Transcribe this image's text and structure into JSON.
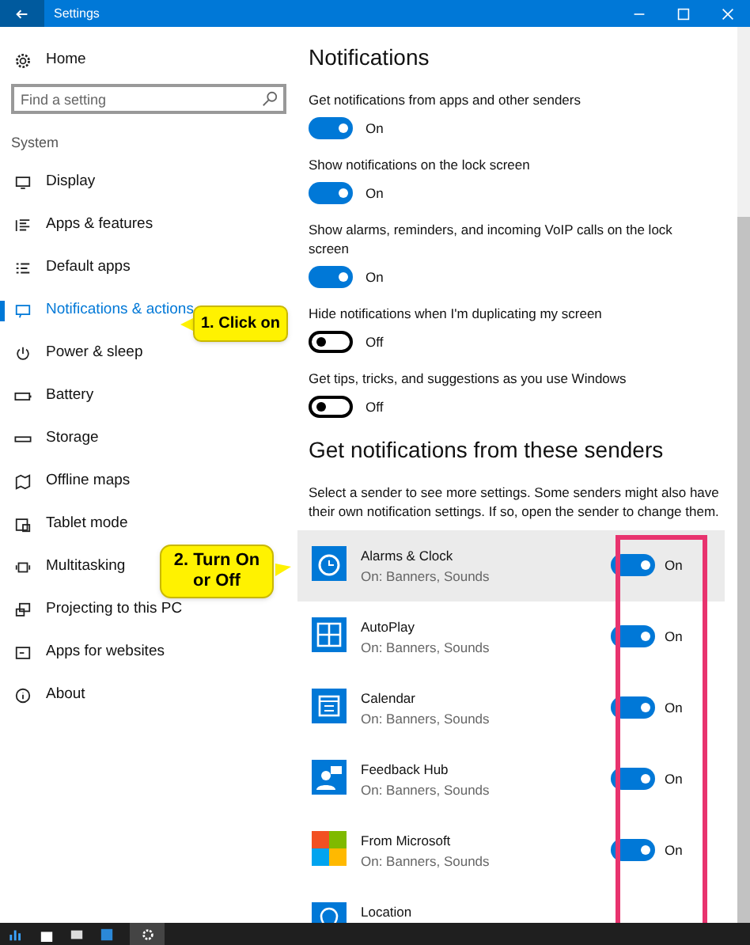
{
  "window": {
    "title": "Settings"
  },
  "sidebar": {
    "home": "Home",
    "search": {
      "placeholder": "Find a setting"
    },
    "section": "System",
    "items": [
      {
        "label": "Display",
        "selected": false
      },
      {
        "label": "Apps & features",
        "selected": false
      },
      {
        "label": "Default apps",
        "selected": false
      },
      {
        "label": "Notifications & actions",
        "selected": true
      },
      {
        "label": "Power & sleep",
        "selected": false
      },
      {
        "label": "Battery",
        "selected": false
      },
      {
        "label": "Storage",
        "selected": false
      },
      {
        "label": "Offline maps",
        "selected": false
      },
      {
        "label": "Tablet mode",
        "selected": false
      },
      {
        "label": "Multitasking",
        "selected": false
      },
      {
        "label": "Projecting to this PC",
        "selected": false
      },
      {
        "label": "Apps for websites",
        "selected": false
      },
      {
        "label": "About",
        "selected": false
      }
    ]
  },
  "main": {
    "heading": "Notifications",
    "settings": [
      {
        "label": "Get notifications from apps and other senders",
        "on": true,
        "state_text": "On"
      },
      {
        "label": "Show notifications on the lock screen",
        "on": true,
        "state_text": "On"
      },
      {
        "label": "Show alarms, reminders, and incoming VoIP calls on the lock screen",
        "on": true,
        "state_text": "On"
      },
      {
        "label": "Hide notifications when I'm duplicating my screen",
        "on": false,
        "state_text": "Off"
      },
      {
        "label": "Get tips, tricks, and suggestions as you use Windows",
        "on": false,
        "state_text": "Off"
      }
    ],
    "senders_heading": "Get notifications from these senders",
    "senders_description": "Select a sender to see more settings. Some senders might also have their own notification settings. If so, open the sender to change them.",
    "senders": [
      {
        "name": "Alarms & Clock",
        "subtitle": "On: Banners, Sounds",
        "on": true,
        "state_text": "On",
        "selected": true
      },
      {
        "name": "AutoPlay",
        "subtitle": "On: Banners, Sounds",
        "on": true,
        "state_text": "On",
        "selected": false
      },
      {
        "name": "Calendar",
        "subtitle": "On: Banners, Sounds",
        "on": true,
        "state_text": "On",
        "selected": false
      },
      {
        "name": "Feedback Hub",
        "subtitle": "On: Banners, Sounds",
        "on": true,
        "state_text": "On",
        "selected": false
      },
      {
        "name": "From Microsoft",
        "subtitle": "On: Banners, Sounds",
        "on": true,
        "state_text": "On",
        "selected": false
      },
      {
        "name": "Location",
        "selected": false
      }
    ]
  },
  "callouts": [
    {
      "text": "1. Click on"
    },
    {
      "text": "2. Turn On or Off"
    }
  ]
}
